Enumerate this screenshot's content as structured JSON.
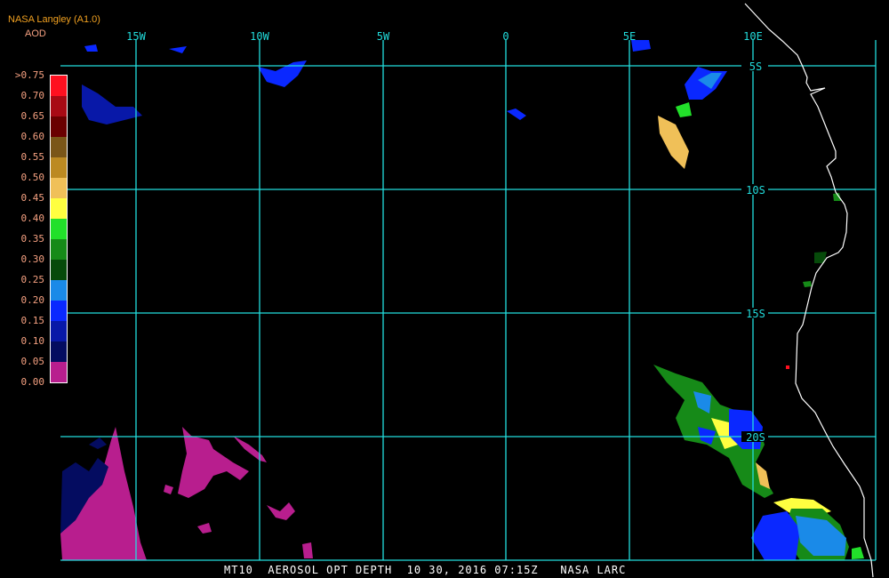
{
  "header": {
    "title": "NASA Langley (A1.0)",
    "subtitle": "AOD"
  },
  "legend": {
    "labels": [
      ">0.75",
      "0.70",
      "0.65",
      "0.60",
      "0.55",
      "0.50",
      "0.45",
      "0.40",
      "0.35",
      "0.30",
      "0.25",
      "0.20",
      "0.15",
      "0.10",
      "0.05",
      "0.00"
    ],
    "colors": [
      "#ff1020",
      "#a80a14",
      "#6a0000",
      "#7a5618",
      "#bc8a22",
      "#f0c058",
      "#ffff40",
      "#22e02a",
      "#168a18",
      "#064a0a",
      "#1a8ae8",
      "#0a28ff",
      "#0818a8",
      "#040c60",
      "#b81e8e"
    ]
  },
  "map": {
    "lon_labels": [
      "15W",
      "10W",
      "5W",
      "0",
      "5E",
      "10E"
    ],
    "lat_labels": [
      "5S",
      "10S",
      "15S",
      "20S"
    ],
    "grid_color": "#22dddd",
    "coast_color": "#ffffff"
  },
  "footer": {
    "text": "MT10  AEROSOL OPT DEPTH  10 30, 2016 07:15Z   NASA LARC"
  }
}
